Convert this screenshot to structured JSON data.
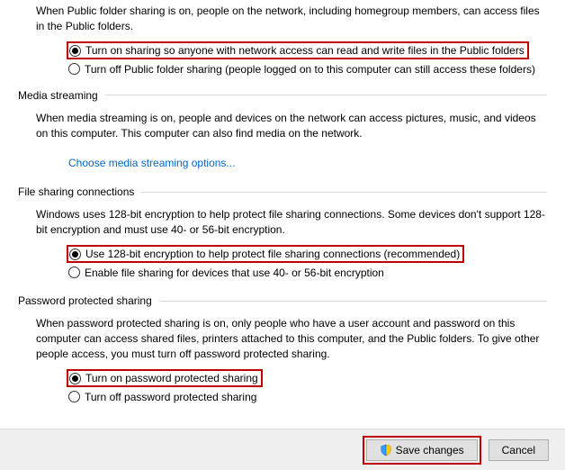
{
  "public_folder": {
    "intro": "When Public folder sharing is on, people on the network, including homegroup members, can access files in the Public folders.",
    "option_on": "Turn on sharing so anyone with network access can read and write files in the Public folders",
    "option_off": "Turn off Public folder sharing (people logged on to this computer can still access these folders)"
  },
  "media": {
    "header": "Media streaming",
    "intro": "When media streaming is on, people and devices on the network can access pictures, music, and videos on this computer. This computer can also find media on the network.",
    "link": "Choose media streaming options..."
  },
  "filesharing": {
    "header": "File sharing connections",
    "intro": "Windows uses 128-bit encryption to help protect file sharing connections. Some devices don't support 128-bit encryption and must use 40- or 56-bit encryption.",
    "option_128": "Use 128-bit encryption to help protect file sharing connections (recommended)",
    "option_40": "Enable file sharing for devices that use 40- or 56-bit encryption"
  },
  "password": {
    "header": "Password protected sharing",
    "intro": "When password protected sharing is on, only people who have a user account and password on this computer can access shared files, printers attached to this computer, and the Public folders. To give other people access, you must turn off password protected sharing.",
    "option_on": "Turn on password protected sharing",
    "option_off": "Turn off password protected sharing"
  },
  "buttons": {
    "save": "Save changes",
    "cancel": "Cancel"
  }
}
